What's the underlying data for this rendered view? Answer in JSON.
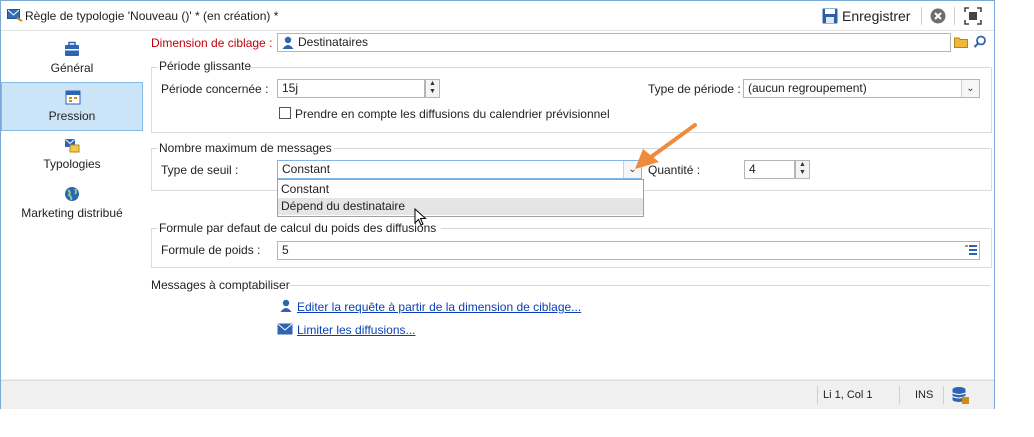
{
  "window": {
    "title": "Règle de typologie 'Nouveau ()' * (en création) *",
    "save_label": "Enregistrer"
  },
  "sidebar": {
    "items": [
      {
        "label": "Général",
        "icon": "briefcase-icon",
        "active": false
      },
      {
        "label": "Pression",
        "icon": "calendar-icon",
        "active": true
      },
      {
        "label": "Typologies",
        "icon": "typology-icon",
        "active": false
      },
      {
        "label": "Marketing distribué",
        "icon": "globe-icon",
        "active": false
      }
    ]
  },
  "targeting": {
    "label": "Dimension de ciblage :",
    "value": "Destinataires"
  },
  "rolling_period": {
    "group_title": "Période glissante",
    "period_label": "Période concernée :",
    "period_value": "15j",
    "period_type_label": "Type de période :",
    "period_type_value": "(aucun regroupement)",
    "checkbox_label": "Prendre en compte les diffusions du calendrier prévisionnel",
    "checkbox_checked": false
  },
  "max_messages": {
    "group_title": "Nombre maximum de messages",
    "threshold_label": "Type de seuil :",
    "threshold_value": "Constant",
    "threshold_options": [
      "Constant",
      "Dépend du destinataire"
    ],
    "quantity_label": "Quantité :",
    "quantity_value": "4"
  },
  "weight_formula": {
    "group_title": "Formule par defaut de calcul du poids des diffusions",
    "label": "Formule de poids :",
    "value": "5"
  },
  "messages_count": {
    "group_title": "Messages à comptabiliser",
    "link_query": "Editer la requête à partir de la dimension de ciblage...",
    "link_limit": "Limiter les diffusions..."
  },
  "status": {
    "position": "Li 1, Col 1",
    "mode": "INS"
  },
  "colors": {
    "accent": "#1e6fc8",
    "required_label": "#c0000c",
    "selection": "#cce4f7",
    "arrow": "#f08a3c"
  }
}
